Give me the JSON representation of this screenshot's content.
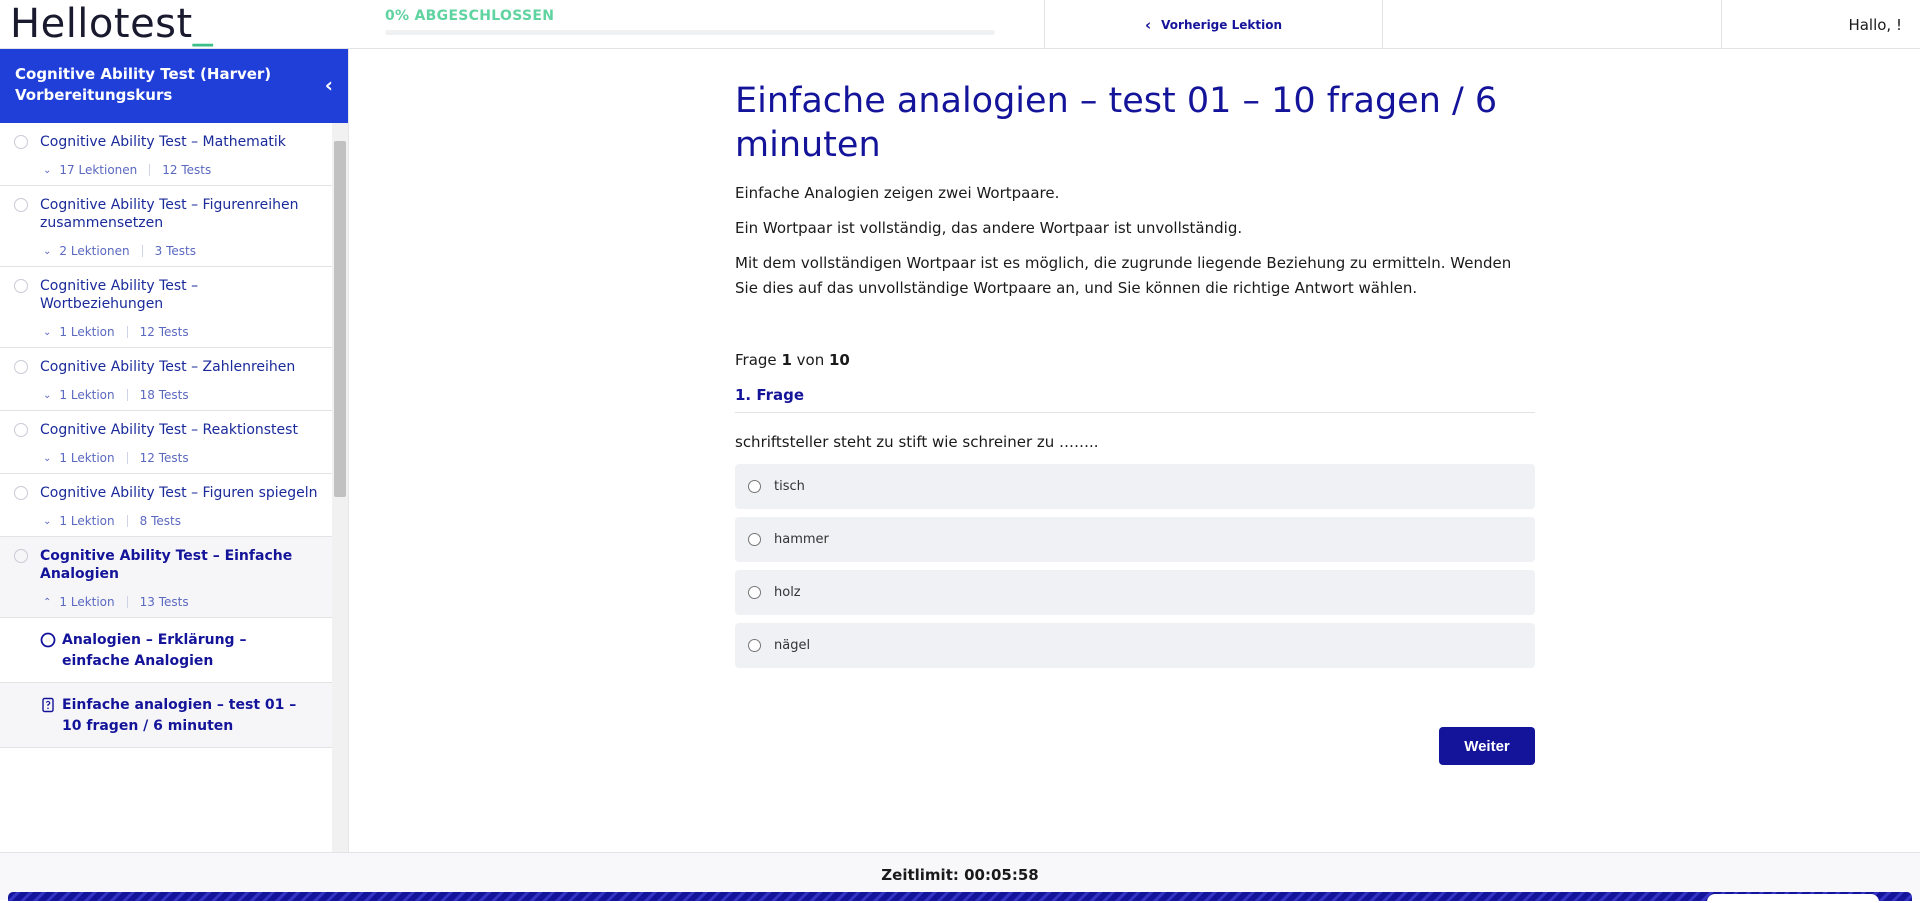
{
  "header": {
    "logo_text": "Hellotest",
    "progress_label": "0% ABGESCHLOSSEN",
    "progress_value": 0,
    "prev_lesson_label": "Vorherige Lektion",
    "greeting": "Hallo, !"
  },
  "sidebar": {
    "course_title": "Cognitive Ability Test (Harver) Vorbereitungskurs",
    "sections": [
      {
        "title": "Cognitive Ability Test – Mathematik",
        "lessons": "17 Lektionen",
        "tests": "12 Tests"
      },
      {
        "title": "Cognitive Ability Test – Figurenreihen zusammensetzen",
        "lessons": "2 Lektionen",
        "tests": "3 Tests"
      },
      {
        "title": "Cognitive Ability Test – Wortbeziehungen",
        "lessons": "1 Lektion",
        "tests": "12 Tests"
      },
      {
        "title": "Cognitive Ability Test – Zahlenreihen",
        "lessons": "1 Lektion",
        "tests": "18 Tests"
      },
      {
        "title": "Cognitive Ability Test – Reaktionstest",
        "lessons": "1 Lektion",
        "tests": "12 Tests"
      },
      {
        "title": "Cognitive Ability Test – Figuren spiegeln",
        "lessons": "1 Lektion",
        "tests": "8 Tests"
      },
      {
        "title": "Cognitive Ability Test – Einfache Analogien",
        "lessons": "1 Lektion",
        "tests": "13 Tests"
      }
    ],
    "sub_items": [
      {
        "label": "Analogien – Erklärung – einfache Analogien",
        "icon": "circle-icon"
      },
      {
        "label": "Einfache analogien – test 01 – 10 fragen / 6 minuten",
        "icon": "quiz-icon"
      }
    ]
  },
  "main": {
    "title": "Einfache analogien – test 01 – 10 fragen / 6 minuten",
    "paragraphs": [
      "Einfache Analogien zeigen zwei Wortpaare.",
      "Ein Wortpaar ist vollständig, das andere Wortpaar ist unvollständig.",
      "Mit dem vollständigen Wortpaar ist es möglich, die zugrunde liegende Beziehung zu ermitteln. Wenden Sie dies auf das unvollständige Wortpaare an, und Sie können die richtige Antwort wählen."
    ],
    "frage_prefix": "Frage",
    "frage_current": "1",
    "frage_of": "von",
    "frage_total": "10",
    "question_heading": "1. Frage",
    "question_text": "schriftsteller steht zu stift wie schreiner zu ……..",
    "options": [
      "tisch",
      "hammer",
      "holz",
      "nägel"
    ],
    "next_button": "Weiter"
  },
  "footer": {
    "timer_label": "Zeitlimit: 00:05:58"
  },
  "colors": {
    "brand_blue": "#14149a",
    "sidebar_header": "#1f3fd8",
    "accent_green": "#5fd3a0"
  }
}
